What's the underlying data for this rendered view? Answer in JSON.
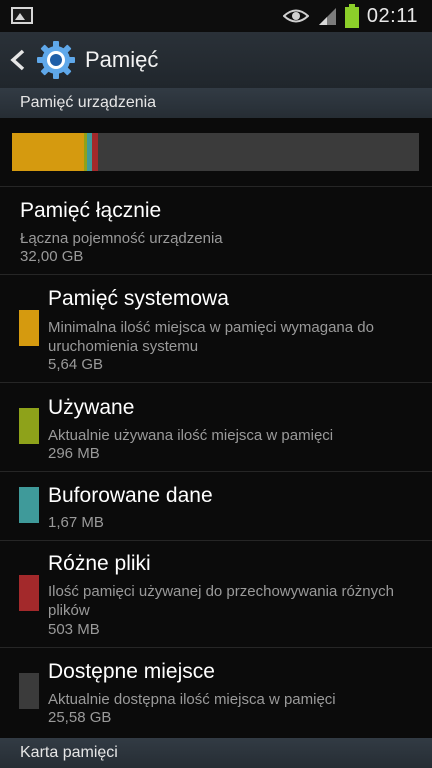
{
  "status_bar": {
    "time": "02:11"
  },
  "action_bar": {
    "title": "Pamięć"
  },
  "sections": {
    "device": "Pamięć urządzenia",
    "card": "Karta pamięci"
  },
  "usage_bar": [
    {
      "name": "system",
      "fraction": 0.176,
      "color": "#d59a0f"
    },
    {
      "name": "used",
      "fraction": 0.009,
      "color": "#8ea21a"
    },
    {
      "name": "cached",
      "fraction": 0.012,
      "color": "#3f9a9a"
    },
    {
      "name": "misc",
      "fraction": 0.015,
      "color": "#a3292b"
    }
  ],
  "total": {
    "title": "Pamięć łącznie",
    "desc": "Łączna pojemność urządzenia",
    "value": "32,00 GB"
  },
  "system": {
    "title": "Pamięć systemowa",
    "desc": "Minimalna ilość miejsca w pamięci wymagana do uruchomienia systemu",
    "value": "5,64 GB",
    "color": "#d59a0f"
  },
  "used": {
    "title": "Używane",
    "desc": "Aktualnie używana ilość miejsca w pamięci",
    "value": "296 MB",
    "color": "#8ea21a"
  },
  "cached": {
    "title": "Buforowane dane",
    "value": "1,67 MB",
    "color": "#3f9a9a"
  },
  "misc": {
    "title": "Różne pliki",
    "desc": "Ilość pamięci używanej do przechowywania różnych plików",
    "value": "503 MB",
    "color": "#a3292b"
  },
  "available": {
    "title": "Dostępne miejsce",
    "desc": "Aktualnie dostępna ilość miejsca w pamięci",
    "value": "25,58 GB",
    "color": "#3b3b3b"
  }
}
